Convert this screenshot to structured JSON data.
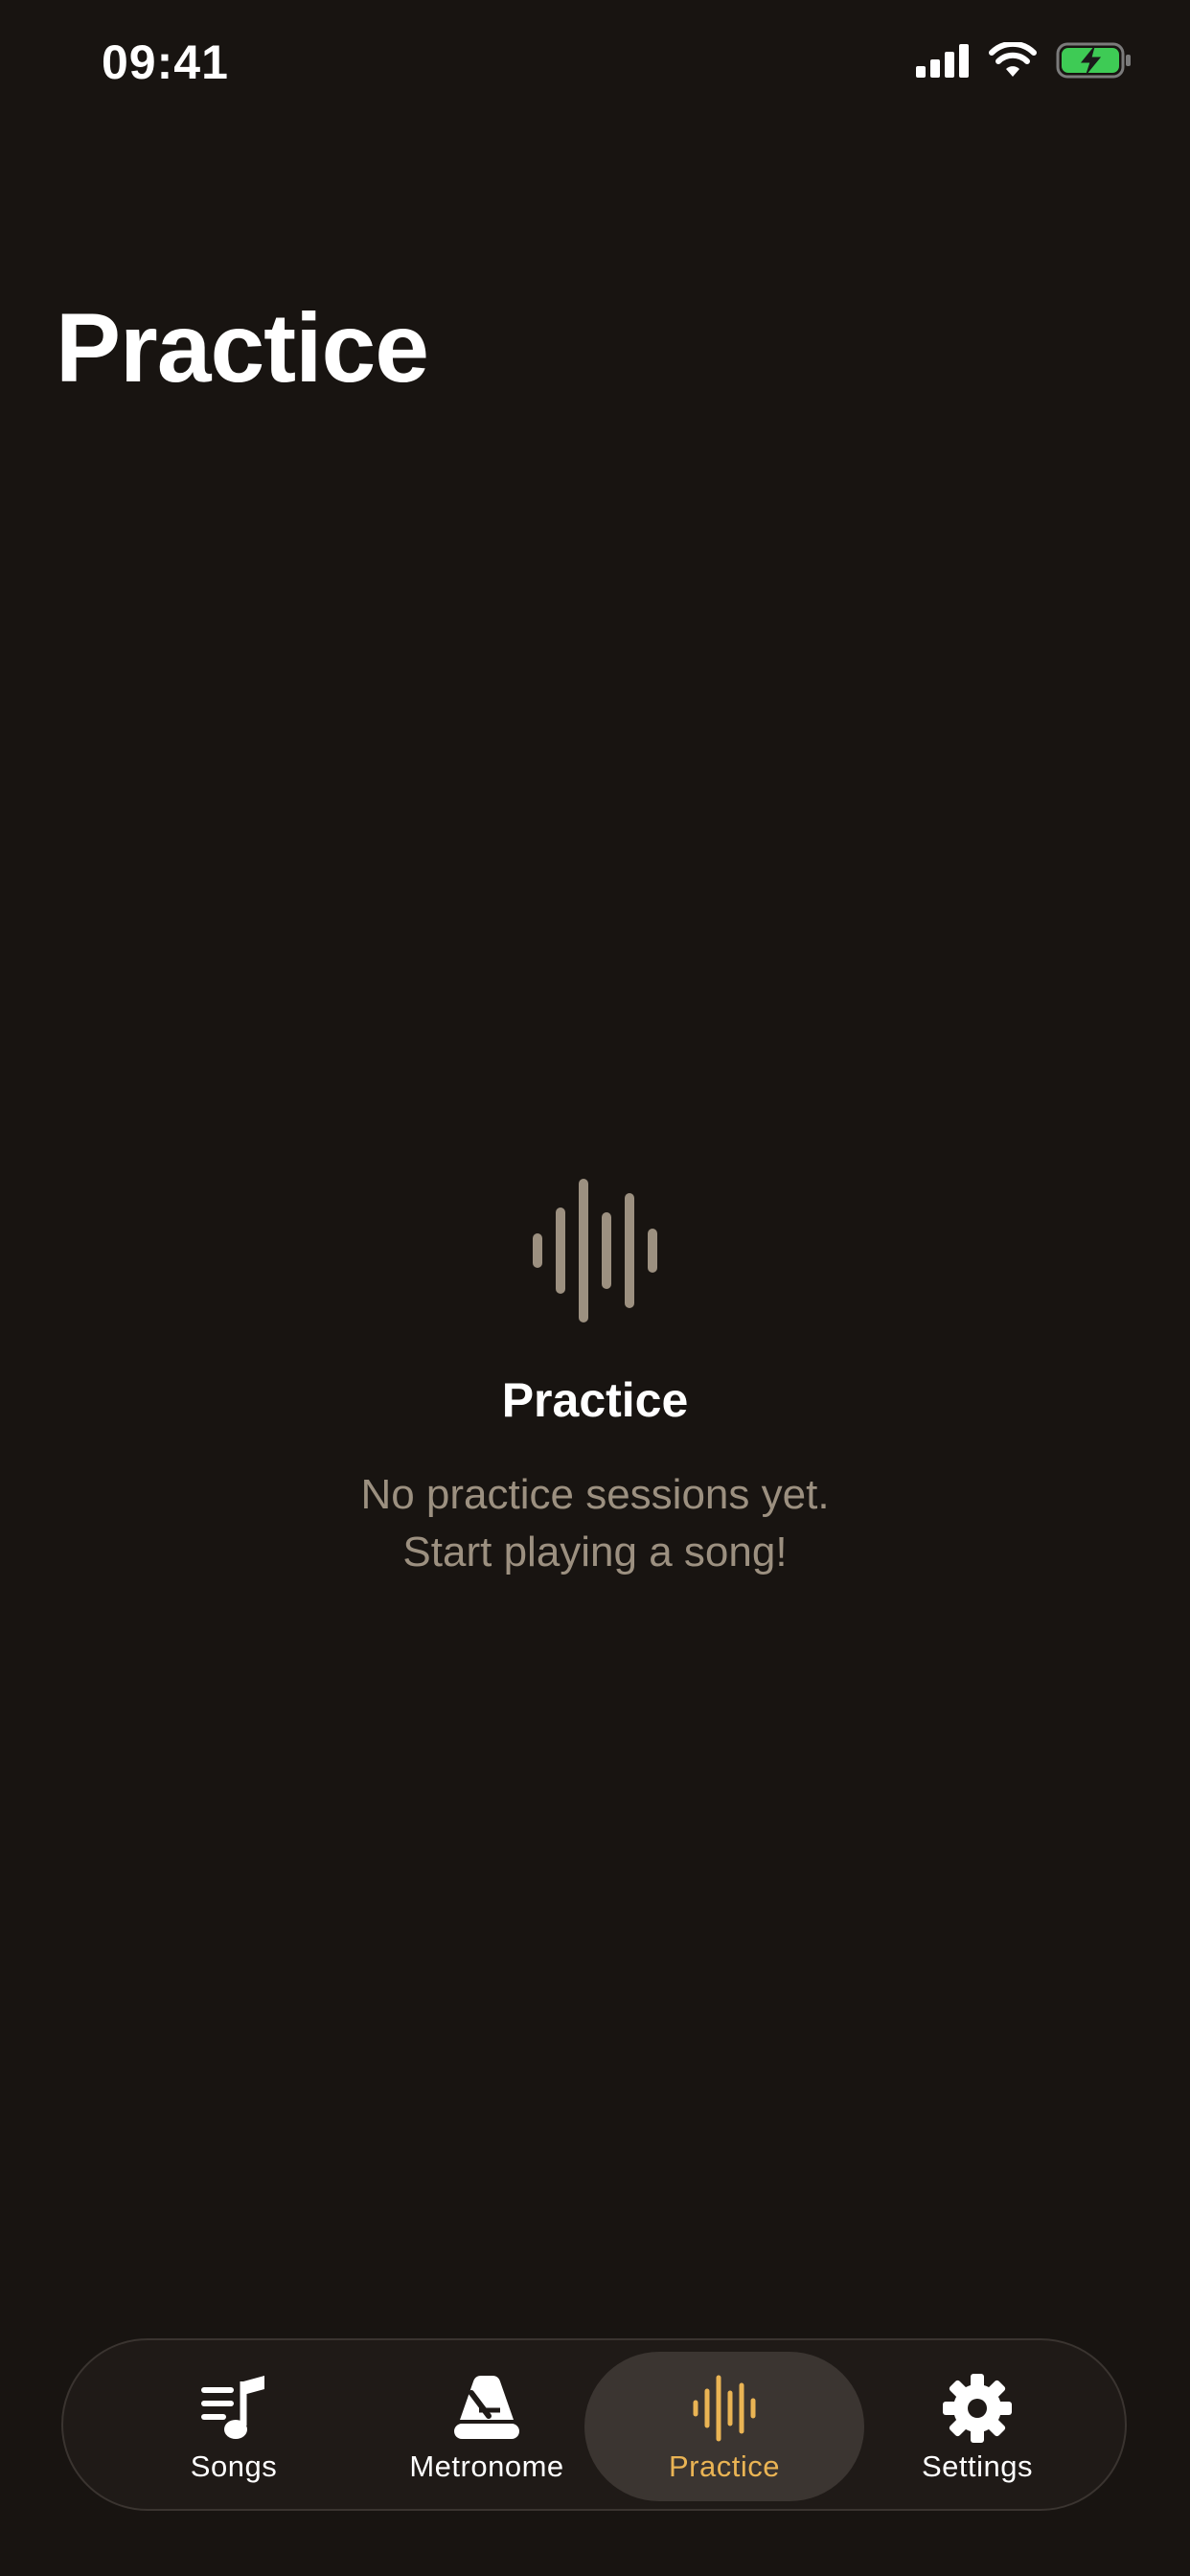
{
  "status_bar": {
    "time": "09:41"
  },
  "header": {
    "title": "Practice"
  },
  "empty_state": {
    "icon": "waveform-icon",
    "title": "Practice",
    "message_line1": "No practice sessions yet.",
    "message_line2": "Start playing a song!"
  },
  "tab_bar": {
    "active_tab": "Practice",
    "accent_color": "#eab454",
    "items": [
      {
        "label": "Songs",
        "icon": "music-list-icon"
      },
      {
        "label": "Metronome",
        "icon": "metronome-icon"
      },
      {
        "label": "Practice",
        "icon": "waveform-icon"
      },
      {
        "label": "Settings",
        "icon": "gear-icon"
      }
    ]
  }
}
